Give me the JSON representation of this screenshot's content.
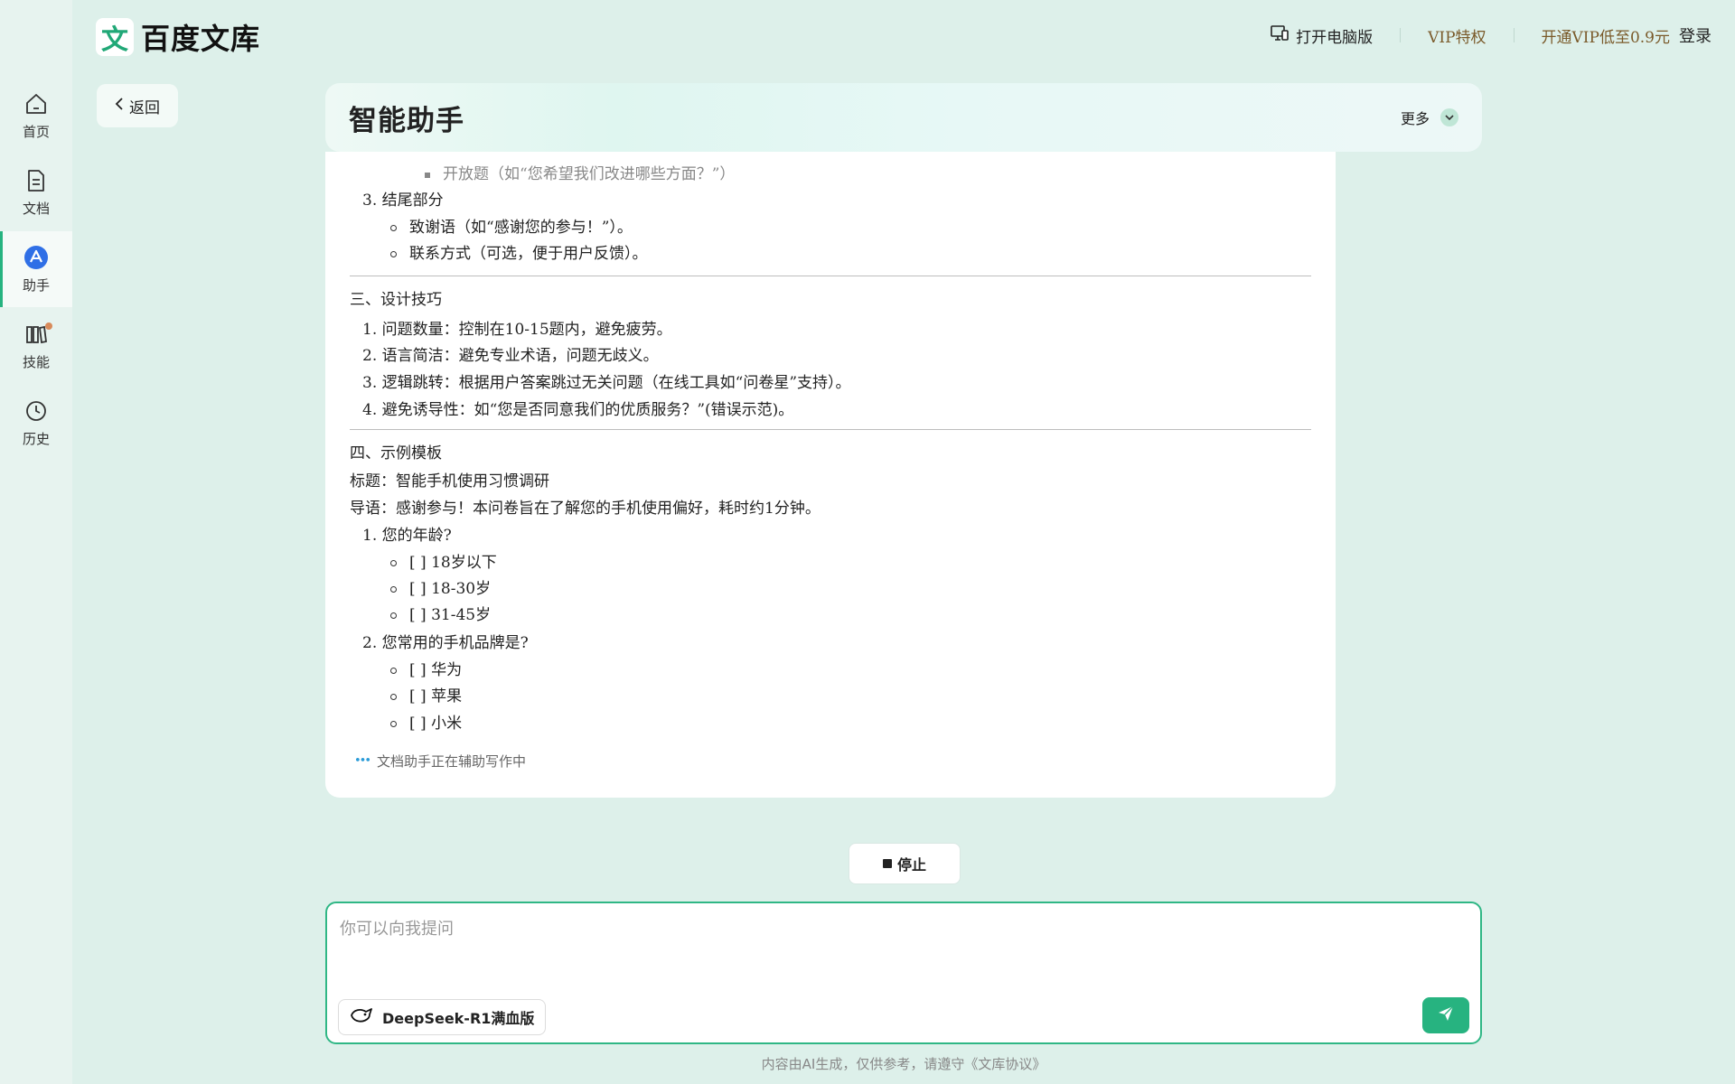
{
  "brand": {
    "logo_char": "文",
    "name": "百度文库"
  },
  "topbar": {
    "open_pc": "打开电脑版",
    "vip": "VIP特权",
    "open_vip": "开通VIP低至0.9元",
    "login": "登录"
  },
  "sidebar": {
    "items": [
      {
        "label": "首页",
        "icon": "home-icon"
      },
      {
        "label": "文档",
        "icon": "document-icon"
      },
      {
        "label": "助手",
        "icon": "assistant-icon",
        "active": true
      },
      {
        "label": "技能",
        "icon": "skills-icon",
        "badge": true
      },
      {
        "label": "历史",
        "icon": "clock-icon"
      }
    ]
  },
  "back_label": "返回",
  "title": "智能助手",
  "more_label": "更多",
  "content": {
    "l0": "开放题（如“您希望我们改进哪些方面？”）",
    "l1": "3. 结尾部分",
    "l2": "致谢语（如“感谢您的参与！”）。",
    "l3": "联系方式（可选，便于用户反馈）。",
    "l4": "三、设计技巧",
    "l5": "1. 问题数量：控制在10-15题内，避免疲劳。",
    "l6": "2. 语言简洁：避免专业术语，问题无歧义。",
    "l7": "3. 逻辑跳转：根据用户答案跳过无关问题（在线工具如“问卷星”支持）。",
    "l8": "4. 避免诱导性：如“您是否同意我们的优质服务？”(错误示范)。",
    "l9": "四、示例模板",
    "l10": "标题：智能手机使用习惯调研",
    "l11": "导语：感谢参与！本问卷旨在了解您的手机使用偏好，耗时约1分钟。",
    "l12": "1. 您的年龄?",
    "l13": "[ ] 18岁以下",
    "l14": "[ ] 18-30岁",
    "l15": "[ ] 31-45岁",
    "l16": "2. 您常用的手机品牌是?",
    "l17": "[ ] 华为",
    "l18": "[ ] 苹果",
    "l19": "[ ] 小米",
    "status": "文档助手正在辅助写作中"
  },
  "stop_label": "停止",
  "input": {
    "placeholder": "你可以向我提问",
    "value": ""
  },
  "model_label": "DeepSeek-R1满血版",
  "footer": "内容由AI生成，仅供参考，请遵守《文库协议》",
  "colors": {
    "accent": "#27b380",
    "background": "#ddf0ea",
    "vip": "#7a5a2a"
  }
}
